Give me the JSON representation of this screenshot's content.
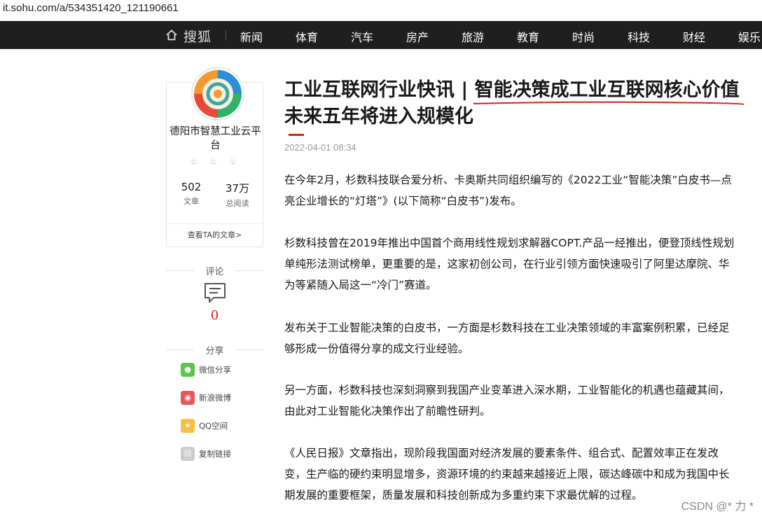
{
  "browser": {
    "url": "it.sohu.com/a/534351420_121190661"
  },
  "topnav": {
    "brand": "搜狐",
    "items": [
      "新闻",
      "体育",
      "汽车",
      "房产",
      "旅游",
      "教育",
      "时尚",
      "科技",
      "财经",
      "娱乐"
    ]
  },
  "author": {
    "name": "德阳市智慧工业云平台",
    "badges": "♧ ♧ ♧",
    "articles_count": "502",
    "articles_label": "文章",
    "reads_count": "37万",
    "reads_label": "总阅读",
    "link": "查看TA的文章>"
  },
  "comments": {
    "title": "评论",
    "count": "0"
  },
  "share": {
    "title": "分享",
    "items": [
      {
        "label": "微信分享",
        "icon": "wechat-icon",
        "color": "#5cc64b"
      },
      {
        "label": "新浪微博",
        "icon": "weibo-icon",
        "color": "#e9555a"
      },
      {
        "label": "QQ空间",
        "icon": "qzone-icon",
        "color": "#f6c043"
      },
      {
        "label": "复制链接",
        "icon": "link-icon",
        "color": "#cccccc"
      }
    ]
  },
  "article": {
    "title": "工业互联网行业快讯 | 智能决策成工业互联网核心价值 未来五年将进入规模化",
    "date": "2022-04-01 08:34",
    "paragraphs": [
      "在今年2月，杉数科技联合爱分析、卡奥斯共同组织编写的《2022工业“智能决策”白皮书—点亮企业增长的“灯塔”》(以下简称“白皮书”)发布。",
      "杉数科技曾在2019年推出中国首个商用线性规划求解器COPT.产品一经推出，便登顶线性规划单纯形法测试榜单，更重要的是，这家初创公司，在行业引领方面快速吸引了阿里达摩院、华为等紧随入局这一“冷门”赛道。",
      "发布关于工业智能决策的白皮书，一方面是杉数科技在工业决策领域的丰富案例积累，已经足够形成一份值得分享的成文行业经验。",
      "另一方面，杉数科技也深刻洞察到我国产业变革进入深水期，工业智能化的机遇也蕴藏其间，由此对工业智能化决策作出了前瞻性研判。",
      "《人民日报》文章指出，现阶段我国面对经济发展的要素条件、组合式、配置效率正在发改变，生产临的硬约束明显增多，资源环境的约束越来越接近上限，碳达峰碳中和成为我国中长期发展的重要框架，质量发展和科技创新成为多重约束下求最优解的过程。"
    ]
  },
  "watermark": "CSDN @* 力 *",
  "colors": {
    "accent": "#d4211c",
    "nav_bg": "#1f1f1f"
  }
}
